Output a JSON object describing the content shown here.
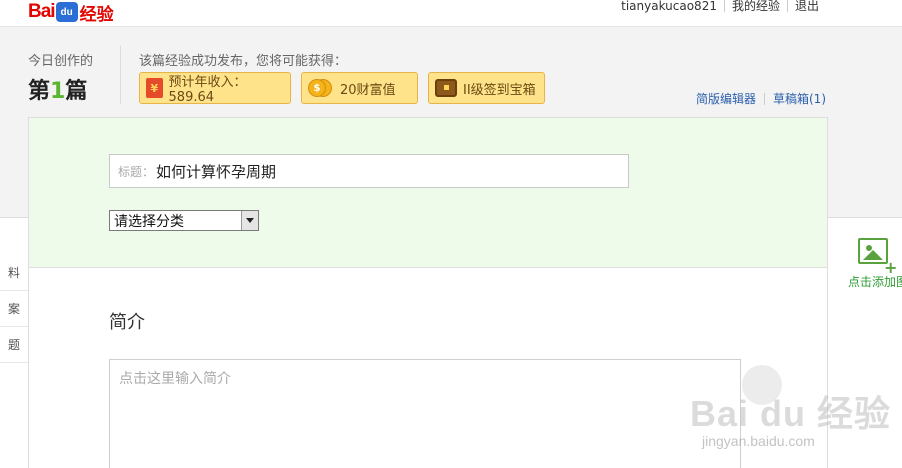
{
  "brand": {
    "logo_left": "Bai",
    "logo_paw": "du",
    "logo_right": "经验"
  },
  "user_nav": {
    "username": "tianyakucao821",
    "my_experience": "我的经验",
    "logout": "退出"
  },
  "stats": {
    "today_label": "今日创作的",
    "count_prefix": "第",
    "count_value": "1",
    "count_suffix": "篇"
  },
  "rewards": {
    "label": "该篇经验成功发布，您将可能获得：",
    "income": "预计年收入：589.64",
    "wealth": "20财富值",
    "chest": "II级签到宝箱"
  },
  "editor_links": {
    "simple_editor": "简版编辑器",
    "drafts": "草稿箱(1)"
  },
  "form": {
    "title_prefix": "标题：",
    "title_value": "如何计算怀孕周期",
    "category_selected": "请选择分类",
    "intro_heading": "简介",
    "intro_placeholder": "点击这里输入简介"
  },
  "left_nav": {
    "items": [
      "料",
      "案",
      "题"
    ]
  },
  "right_panel": {
    "add_image_label": "点击添加图片"
  },
  "watermark": {
    "main": "Bai du 经验",
    "sub": "jingyan.baidu.com"
  },
  "colors": {
    "brand_red": "#e10601",
    "accent_green": "#5cb531",
    "badge_yellow": "#ffe38a",
    "link_blue": "#2b5fad"
  }
}
